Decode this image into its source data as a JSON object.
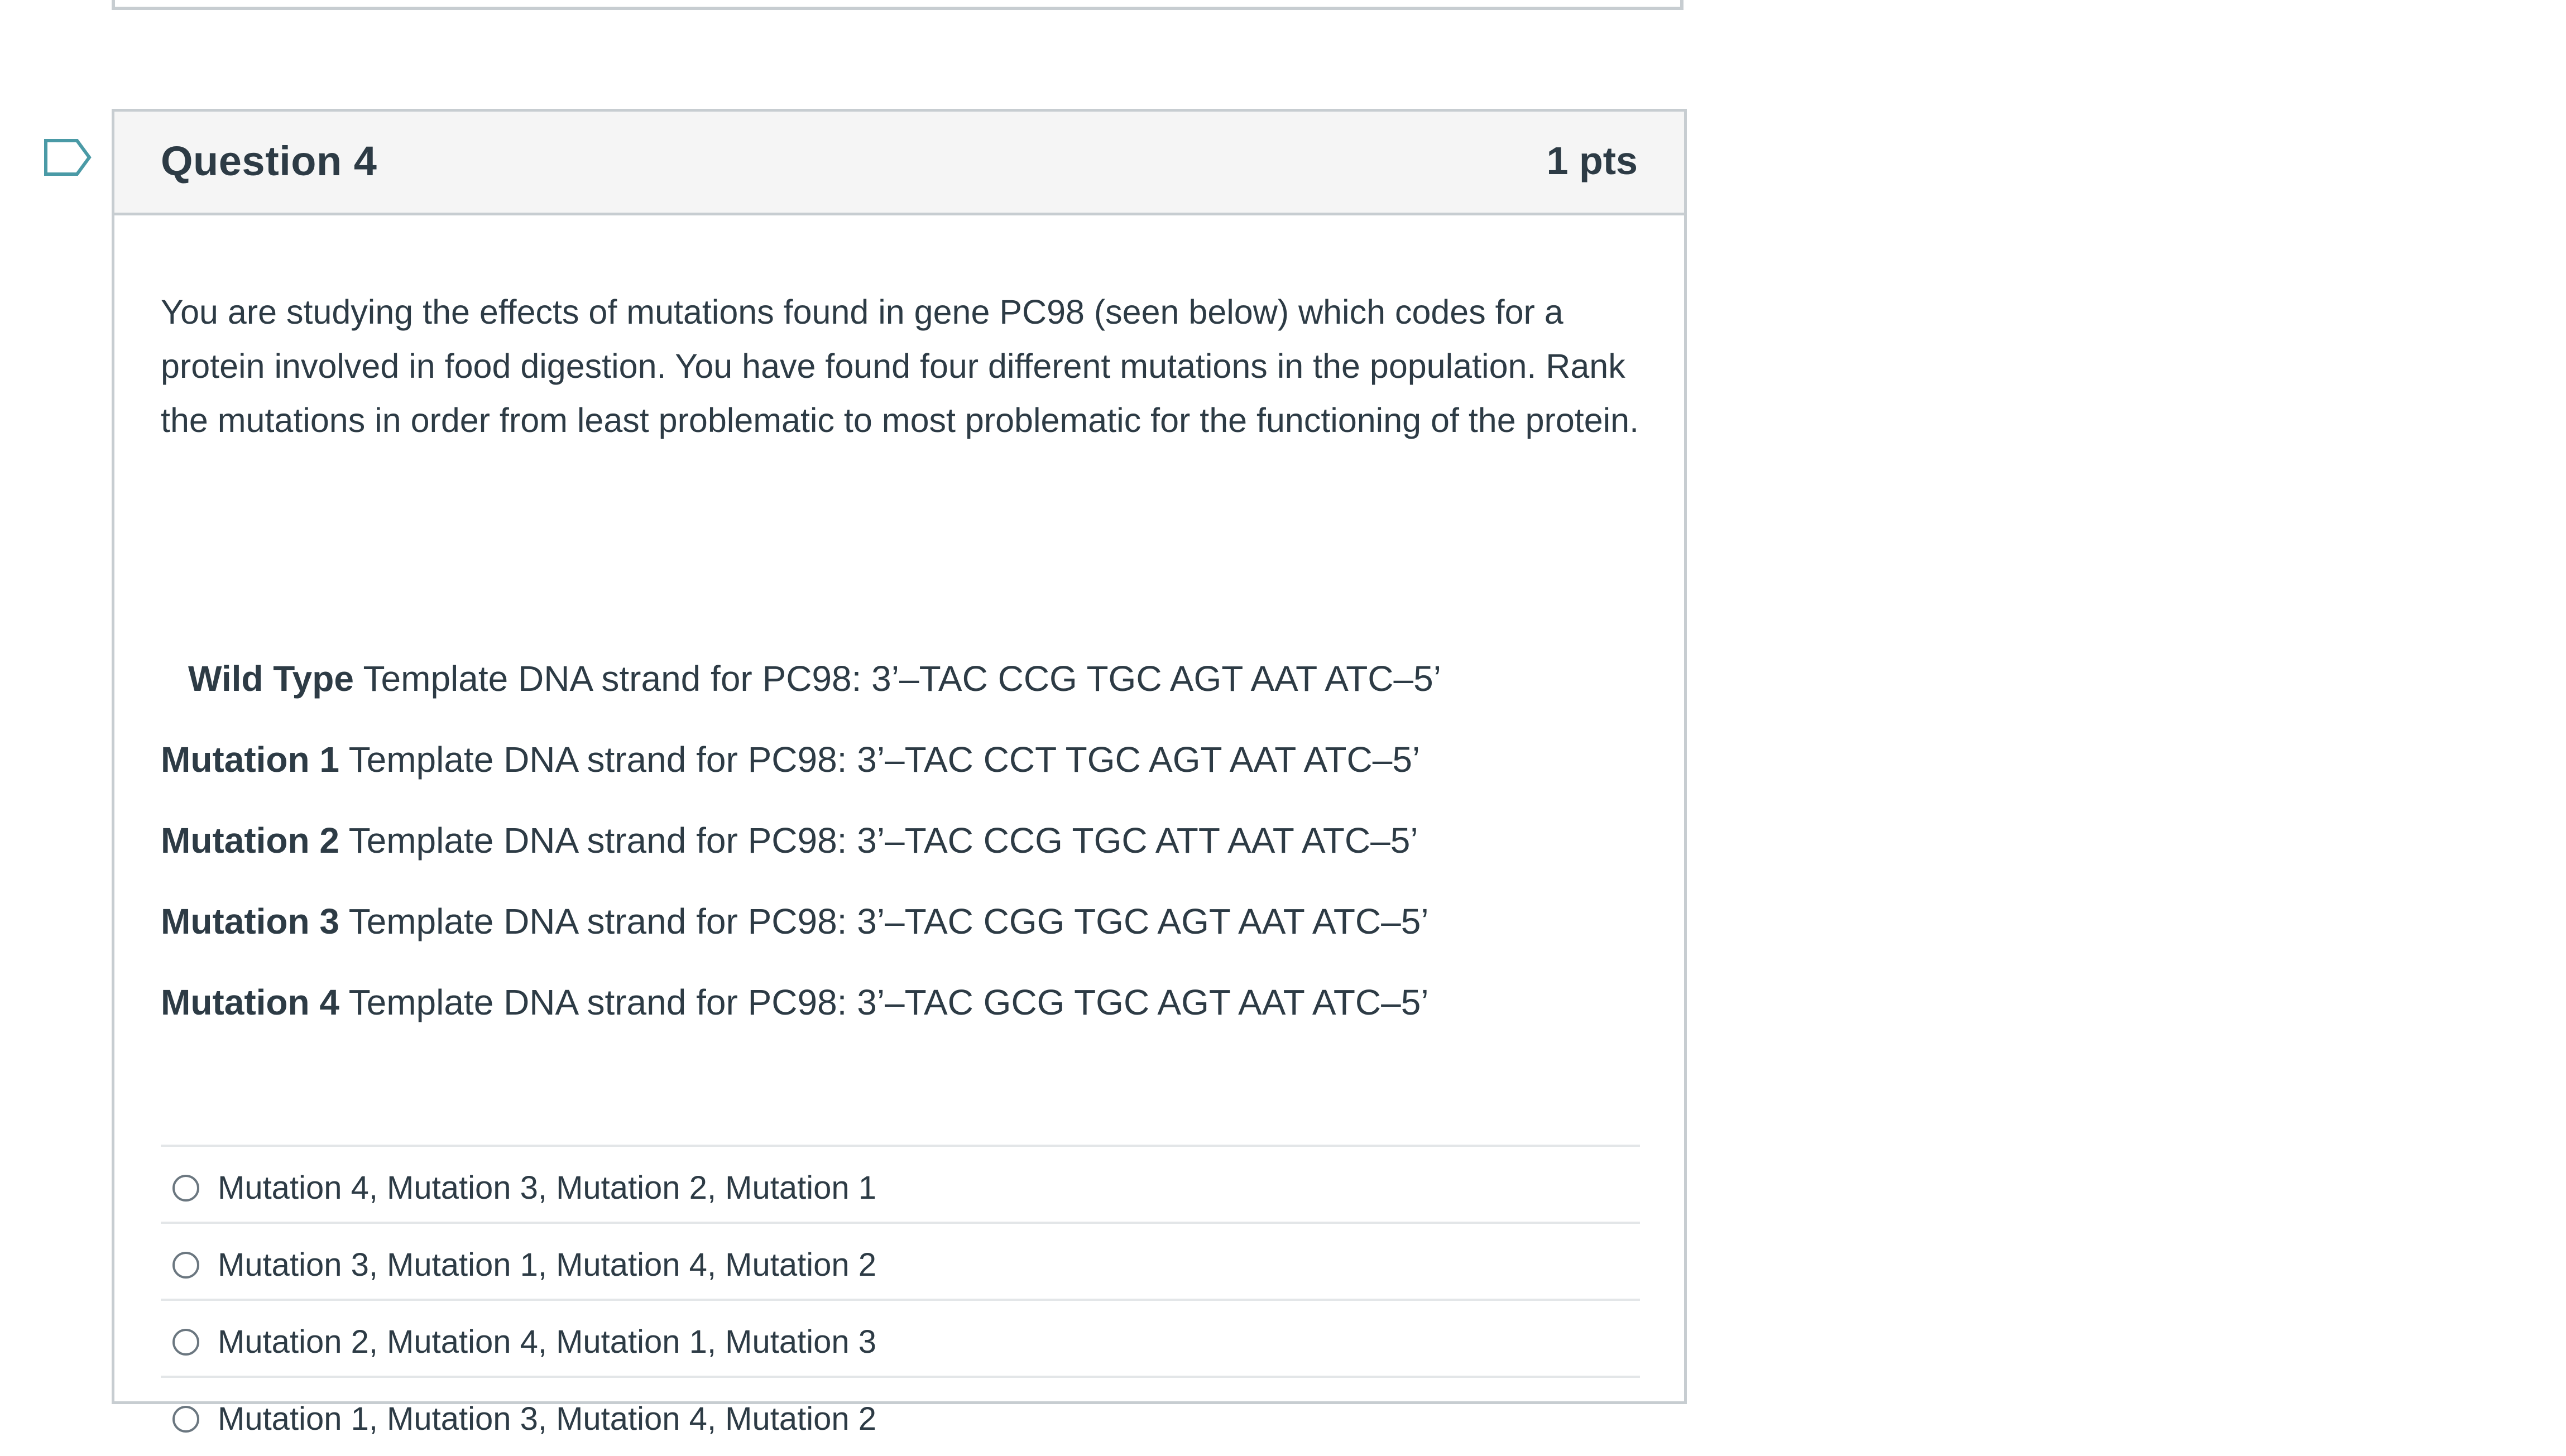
{
  "question": {
    "title": "Question 4",
    "points": "1 pts",
    "prompt": "You are studying the effects of mutations found in gene PC98 (seen below) which codes for a protein involved in food digestion. You have found four different mutations in the population. Rank the mutations in order from least problematic to most problematic for the functioning of the protein.",
    "sequences": [
      {
        "label": "Wild Type",
        "text": " Template DNA strand for PC98: 3’–TAC CCG TGC AGT AAT ATC–5’"
      },
      {
        "label": "Mutation 1",
        "text": " Template DNA strand for PC98:  3’–TAC CCT TGC AGT AAT ATC–5’"
      },
      {
        "label": "Mutation 2",
        "text": " Template DNA strand for PC98:  3’–TAC CCG TGC ATT AAT ATC–5’"
      },
      {
        "label": "Mutation 3",
        "text": " Template DNA strand for PC98:  3’–TAC CGG TGC AGT AAT ATC–5’"
      },
      {
        "label": "Mutation 4",
        "text": " Template DNA strand for PC98: 3’–TAC GCG TGC AGT AAT ATC–5’"
      }
    ],
    "answers": [
      "Mutation 4, Mutation 3, Mutation 2, Mutation 1",
      "Mutation 3, Mutation 1, Mutation 4, Mutation 2",
      "Mutation 2, Mutation 4, Mutation 1, Mutation 3",
      "Mutation 1, Mutation 3, Mutation 4, Mutation 2"
    ]
  },
  "icons": {
    "flag": "flag-icon",
    "radio": "radio-unselected-icon"
  },
  "colors": {
    "border": "#c7cdd1",
    "header_bg": "#f5f5f5",
    "text": "#2d3b45",
    "flag": "#4a9aa6",
    "divider": "#e3e6e8"
  }
}
